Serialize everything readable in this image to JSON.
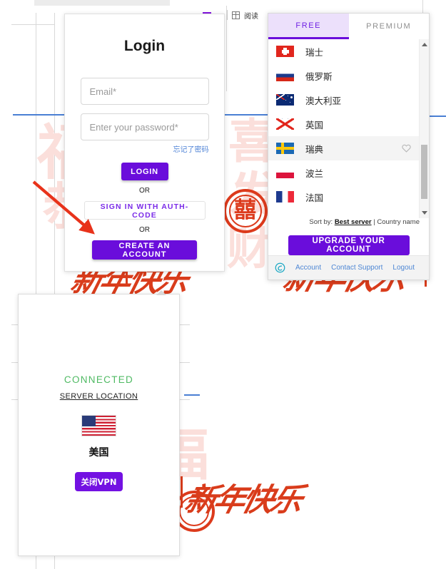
{
  "background": {
    "help_badge": "?",
    "toolbar_text": "阅读",
    "watermarks": [
      "福",
      "恭",
      "喜",
      "发",
      "财"
    ],
    "seal_glyph": "囍",
    "calligraphy": "新年快乐"
  },
  "login_popup": {
    "title": "Login",
    "email_placeholder": "Email*",
    "email_value": "",
    "password_placeholder": "Enter your password*",
    "password_value": "",
    "forgot_link": "忘记了密码",
    "login_button": "LOGIN",
    "or_text_1": "OR",
    "authcode_button": "SIGN IN WITH AUTH-CODE",
    "or_text_2": "OR",
    "create_account_button": "CREATE AN ACCOUNT"
  },
  "vpn_panel": {
    "tabs": [
      {
        "label": "FREE",
        "active": true
      },
      {
        "label": "PREMIUM",
        "active": false
      }
    ],
    "countries": [
      {
        "name": "瑞士",
        "flag": "flag-ch",
        "hovered": false,
        "favorite_icon": false
      },
      {
        "name": "俄罗斯",
        "flag": "flag-ru",
        "hovered": false,
        "favorite_icon": false
      },
      {
        "name": "澳大利亚",
        "flag": "flag-au",
        "hovered": false,
        "favorite_icon": false
      },
      {
        "name": "英国",
        "flag": "flag-gb",
        "hovered": false,
        "favorite_icon": false
      },
      {
        "name": "瑞典",
        "flag": "flag-se",
        "hovered": true,
        "favorite_icon": true
      },
      {
        "name": "波兰",
        "flag": "flag-pl",
        "hovered": false,
        "favorite_icon": false
      },
      {
        "name": "法国",
        "flag": "flag-fr",
        "hovered": false,
        "favorite_icon": false
      }
    ],
    "sort_prefix": "Sort by:",
    "sort_active": "Best server",
    "sort_separator": "|",
    "sort_option": "Country name",
    "upgrade_button": "UPGRADE YOUR ACCOUNT",
    "footer_links": [
      "Account",
      "Contact Support",
      "Logout"
    ]
  },
  "connected_panel": {
    "status": "CONNECTED",
    "server_location_label": "SERVER LOCATION",
    "country": "美国",
    "flag": "flag-us",
    "disconnect_button": "关闭VPN"
  },
  "colors": {
    "accent_purple": "#6a0ddb",
    "tab_active_bg": "#ece0fb",
    "connected_green": "#4fba63",
    "link_blue": "#4e87d4",
    "annotation_red": "#e8321a"
  }
}
